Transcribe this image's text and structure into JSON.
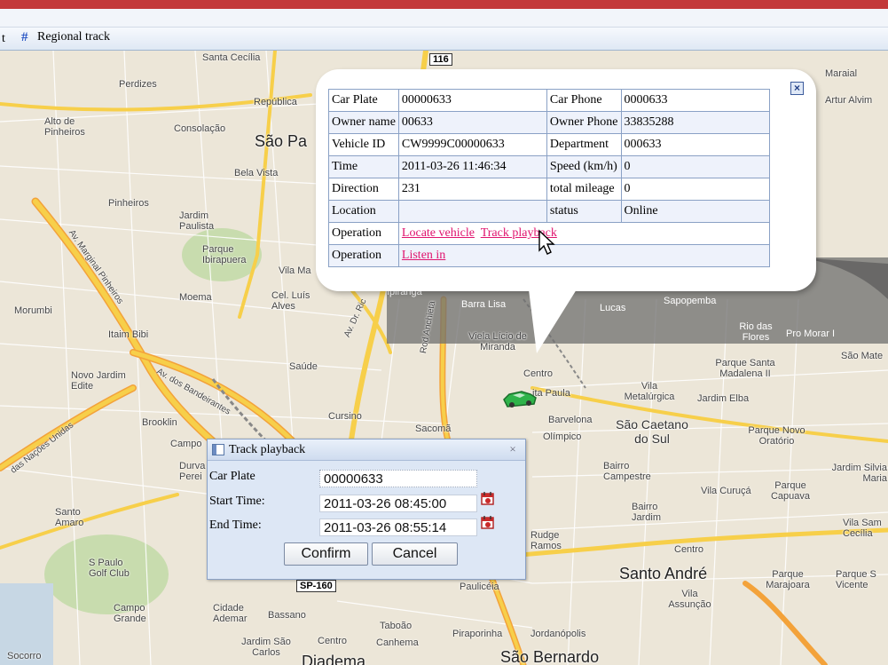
{
  "toolbar": {
    "partial_label": "t",
    "regional_track_label": "Regional track",
    "regional_track_icon": "grid-icon"
  },
  "map": {
    "labels": {
      "santa_cecilia": "Santa Cecília",
      "perdizes": "Perdizes",
      "republica": "República",
      "alto_pinheiros": "Alto de Pinheiros",
      "consolacao": "Consolação",
      "sao_paulo": "São Pa",
      "bela_vista": "Bela Vista",
      "pinheiros": "Pinheiros",
      "jardim_paulista": "Jardim Paulista",
      "parque_ibirapuera": "Parque Ibirapuera",
      "vila_ma": "Vila Ma",
      "moema": "Moema",
      "cel_luis_alves": "Cel. Luís Alves",
      "morumbi": "Morumbi",
      "itaim_bibi": "Itaim Bibi",
      "saude": "Saúde",
      "novo_jardim_edite": "Novo Jardim Edite",
      "brooklin": "Brooklin",
      "campo": "Campo",
      "durval": "Durva Perei",
      "santo_amaro": "Santo Amaro",
      "s_paulo_golf": "S Paulo Golf Club",
      "campo_grande": "Campo Grande",
      "cidade_ademar": "Cidade Ademar",
      "bassano": "Bassano",
      "jardim_sao_carlos": "Jardim São Carlos",
      "centro_sw": "Centro",
      "socorro": "Socorro",
      "diadema": "Diadema",
      "taboao": "Taboão",
      "canhema": "Canhema",
      "pauliceia": "Paulicéia",
      "piraporinha": "Piraporinha",
      "jordanopolis": "Jordanópolis",
      "sao_bernardo": "São Bernardo",
      "rudge_ramos": "Rudge Ramos",
      "santo_andre": "Santo André",
      "vila_assuncao": "Vila Assunção",
      "parque_marajoara": "Parque Marajoara",
      "parque_s_vicente": "Parque S Vicente",
      "centro_sa": "Centro",
      "bairro_jardim": "Bairro Jardim",
      "vila_curuca": "Vila Curuçá",
      "parque_capuava": "Parque Capuava",
      "jardim_silvia_maria": "Jardim Silvia Maria",
      "vila_sam_cecilia": "Vila Sam Cecília",
      "bairro_campestre": "Bairro Campestre",
      "sao_caetano": "São Caetano do Sul",
      "parque_novo_oratorio": "Parque Novo Oratório",
      "olimpico": "Olímpico",
      "barvelona": "Barvelona",
      "sacoma": "Sacomã",
      "cursino": "Cursino",
      "vila_metalurgica": "Vila Metalúrgica",
      "jardim_elba": "Jardim Elba",
      "parque_santa_madalena": "Parque Santa Madalena II",
      "sao_mate": "São Mate",
      "rio_das_flores": "Rio das Flores",
      "pro_morar": "Pro Morar I",
      "sapopemba": "Sapopemba",
      "lucas": "Lucas",
      "barra_lisa": "Barra Lisa",
      "viela_licio": "Viela Lício de Miranda",
      "centro_mid": "Centro",
      "sta_paula": "ita Paula",
      "ipiranga": "Ipiranga",
      "maraial": "Maraial",
      "artur_alvim": "Artur Alvim",
      "rod_anchieta": "Rod Anchieta",
      "av_dos_bandeirantes": "Av. dos Bandeirantes",
      "av_marginal_pinheiros": "Av. Marginal Pinheiros",
      "das_nacoes_unidas": "das Nações Unidas",
      "av_dr_ric": "Av. Dr. Ric"
    },
    "shields": {
      "r116": "116",
      "sp160": "SP-160"
    }
  },
  "vehicle_popup": {
    "close_icon": "close-icon",
    "rows": [
      {
        "l1": "Car Plate",
        "v1": "00000633",
        "l2": "Car Phone",
        "v2": "0000633"
      },
      {
        "l1": "Owner name",
        "v1": "00633",
        "l2": "Owner Phone",
        "v2": "33835288"
      },
      {
        "l1": "Vehicle ID",
        "v1": "CW9999C00000633",
        "l2": "Department",
        "v2": "000633"
      },
      {
        "l1": "Time",
        "v1": "2011-03-26 11:46:34",
        "l2": "Speed (km/h)",
        "v2": "0"
      },
      {
        "l1": "Direction",
        "v1": "231",
        "l2": "total mileage",
        "v2": "0"
      },
      {
        "l1": "Location",
        "v1": "",
        "l2": "status",
        "v2": "Online"
      }
    ],
    "operation_label": "Operation",
    "locate_vehicle": "Locate vehicle",
    "track_playback": "Track playback",
    "listen_in": "Listen in"
  },
  "track_dialog": {
    "title": "Track playback",
    "close_label": "×",
    "car_plate_label": "Car Plate",
    "car_plate_value": "00000633",
    "start_time_label": "Start Time:",
    "start_time_value": "2011-03-26 08:45:00",
    "end_time_label": "End Time:",
    "end_time_value": "2011-03-26 08:55:14",
    "confirm_label": "Confirm",
    "cancel_label": "Cancel",
    "calendar_icon": "calendar-icon"
  },
  "colors": {
    "brand_red": "#c3393a",
    "link_pink": "#e0146e",
    "table_border": "#8aa1c5",
    "road_yellow": "#f7cf4a",
    "road_orange": "#f3a23a"
  }
}
